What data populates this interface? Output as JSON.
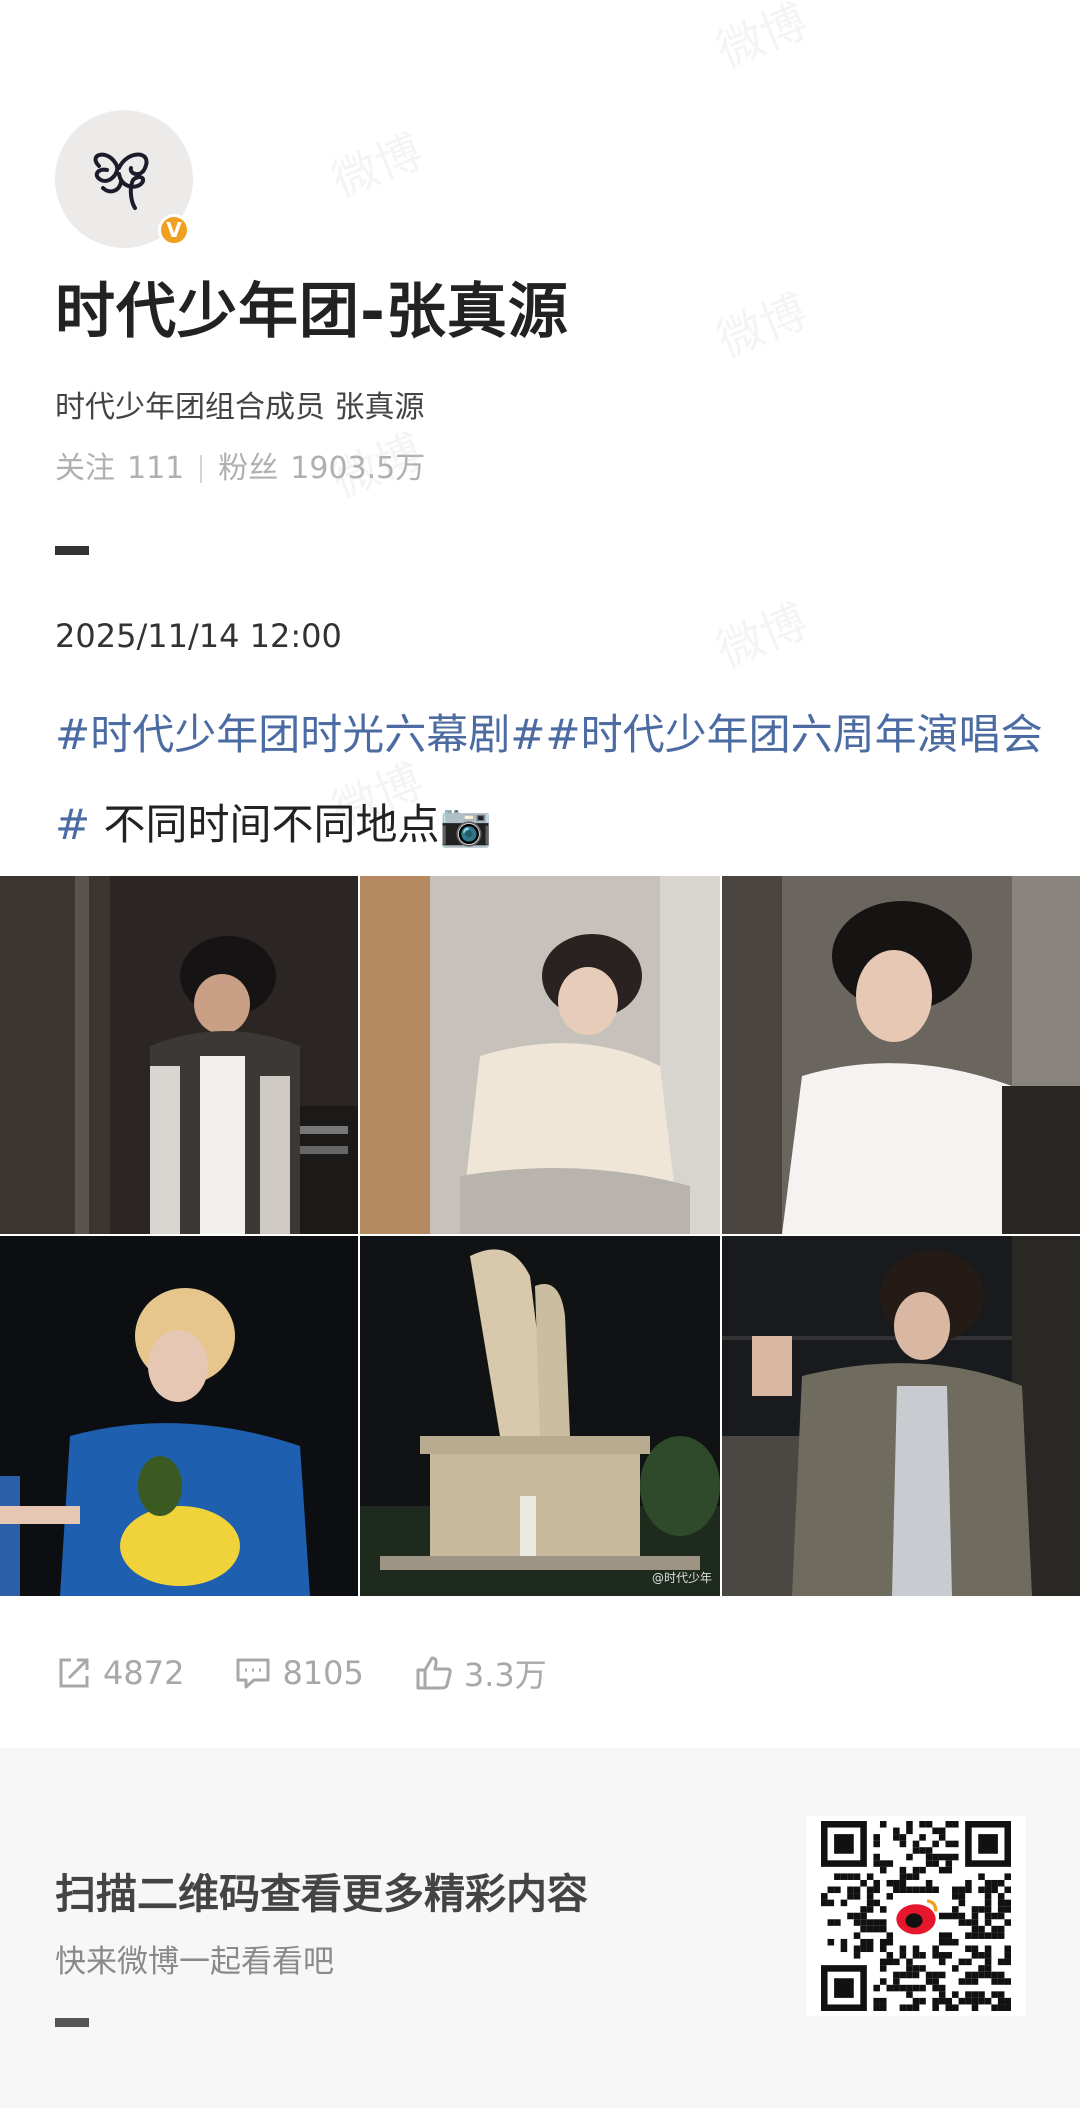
{
  "watermark_text": "微博",
  "profile": {
    "name": "时代少年团-张真源",
    "description": "时代少年团组合成员 张真源",
    "following_label": "关注",
    "following_count": "111",
    "followers_label": "粉丝",
    "followers_count": "1903.5万",
    "verified_badge": "V"
  },
  "post": {
    "timestamp": "2025/11/14 12:00",
    "hashtag_1": "#时代少年团时光六幕剧#",
    "hashtag_2": "#时代少年团六周年演唱会#",
    "text": " 不同时间不同地点",
    "emoji": "📷",
    "image_watermark": "@时代少年",
    "photos": [
      {
        "name": "photo-checkered-jacket",
        "dominant": "#2d2825"
      },
      {
        "name": "photo-white-shirt-seated",
        "dominant": "#c9c4ba"
      },
      {
        "name": "photo-profile-white-shirt",
        "dominant": "#6e6963"
      },
      {
        "name": "photo-blue-floral-shirt",
        "dominant": "#0d0f14"
      },
      {
        "name": "photo-statue-night",
        "dominant": "#141516"
      },
      {
        "name": "photo-leather-jacket",
        "dominant": "#1a1c20"
      }
    ]
  },
  "actions": {
    "share_count": "4872",
    "comment_count": "8105",
    "like_count": "3.3万"
  },
  "footer": {
    "title": "扫描二维码查看更多精彩内容",
    "subtitle": "快来微博一起看看吧"
  },
  "colors": {
    "hashtag": "#4b6ba2",
    "verified": "#f0a020",
    "footer_bg": "#f7f7f7"
  }
}
